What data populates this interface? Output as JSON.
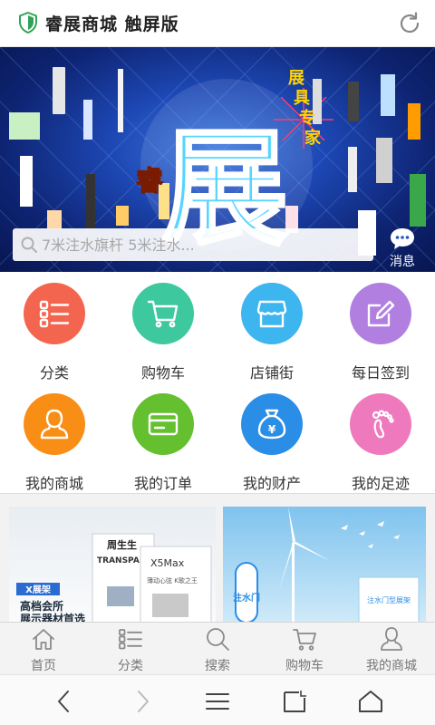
{
  "app": {
    "title": "睿展商城 触屏版"
  },
  "banner": {
    "logo_char": "展",
    "brand_char": "睿",
    "slogan": "展具专家",
    "search_placeholder": "7米注水旗杆 5米注水...",
    "message_label": "消息"
  },
  "menu": [
    {
      "label": "分类",
      "icon": "list-icon",
      "color": "#f4654f"
    },
    {
      "label": "购物车",
      "icon": "cart-icon",
      "color": "#3ec89d"
    },
    {
      "label": "店铺街",
      "icon": "shop-icon",
      "color": "#3db5ee"
    },
    {
      "label": "每日签到",
      "icon": "edit-icon",
      "color": "#b07fe0"
    },
    {
      "label": "我的商城",
      "icon": "user-icon",
      "color": "#f98e17"
    },
    {
      "label": "我的订单",
      "icon": "card-icon",
      "color": "#64c02e"
    },
    {
      "label": "我的财产",
      "icon": "money-bag-icon",
      "color": "#2b8ee6"
    },
    {
      "label": "我的足迹",
      "icon": "footprint-icon",
      "color": "#ef79bd"
    }
  ],
  "products": {
    "left": {
      "tag": "X展架",
      "line1": "高档会所",
      "line2": "展示器材首选",
      "brand1": "周生生",
      "brand2": "TRANSPA",
      "brand3": "X5Max",
      "sub": "薄动心弦 K歌之王"
    },
    "right": {
      "tag": "注水门",
      "vtext": "注水门型展架"
    }
  },
  "tabs": [
    {
      "label": "首页",
      "icon": "home-icon"
    },
    {
      "label": "分类",
      "icon": "list-icon"
    },
    {
      "label": "搜索",
      "icon": "search-icon"
    },
    {
      "label": "购物车",
      "icon": "cart-icon"
    },
    {
      "label": "我的商城",
      "icon": "user-icon"
    }
  ]
}
